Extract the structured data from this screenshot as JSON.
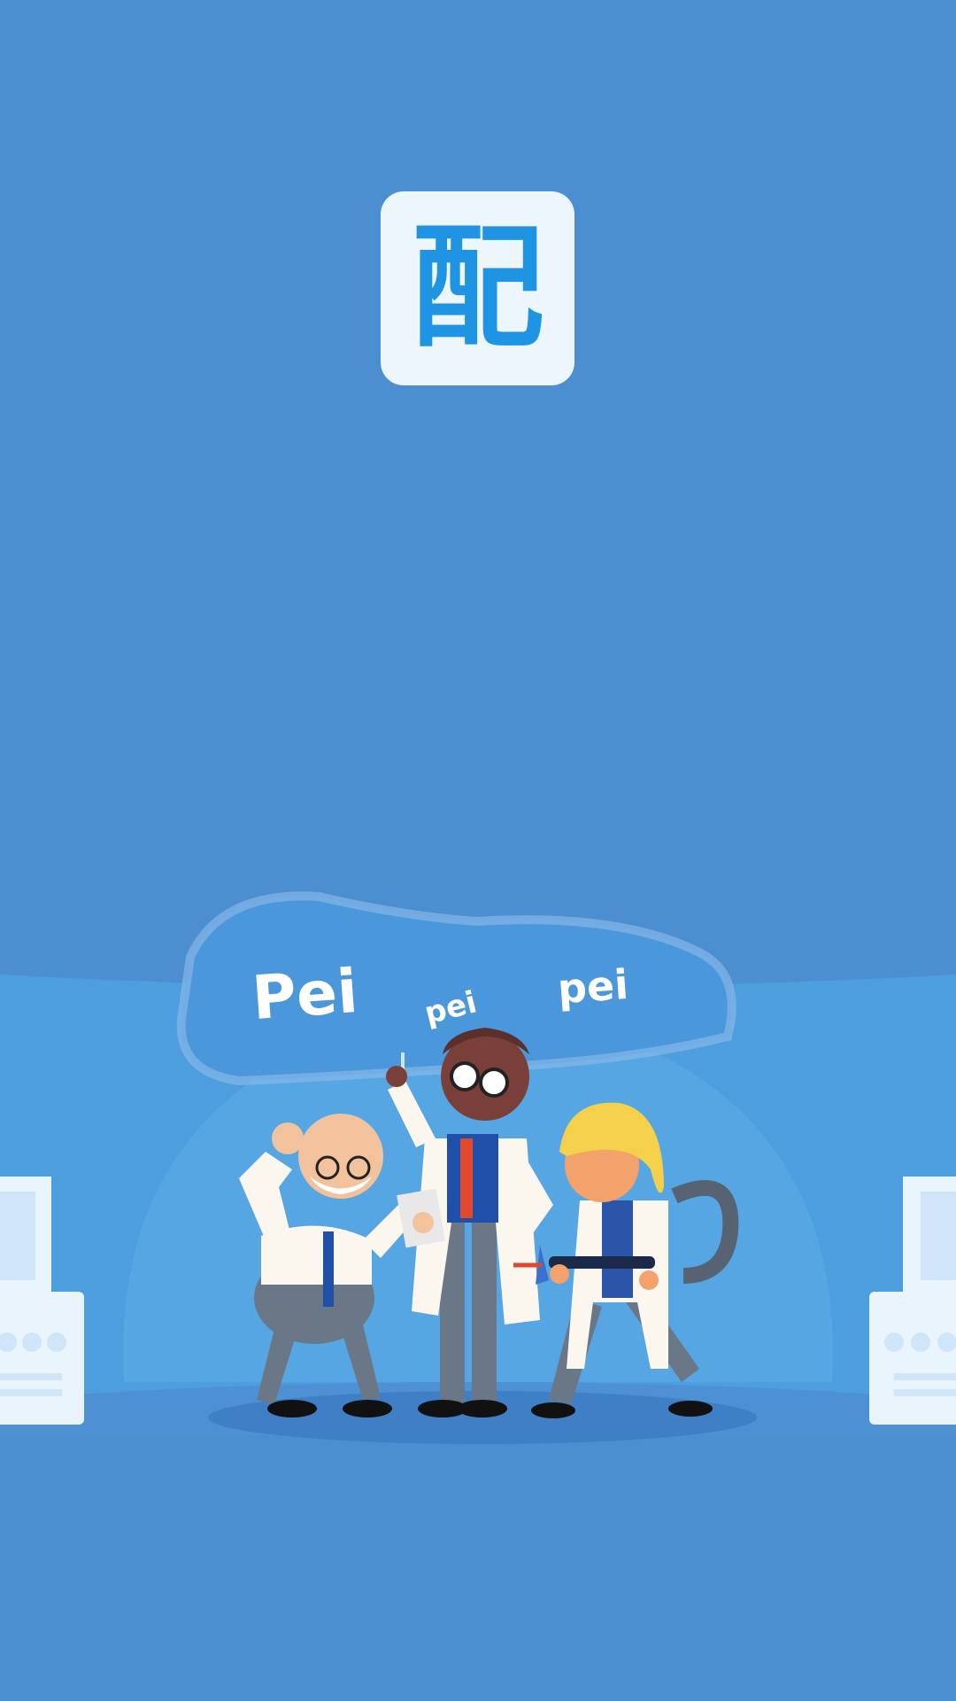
{
  "splash": {
    "logo_char": "配",
    "bubble_words": [
      "Pei",
      "pei",
      "pei"
    ]
  },
  "colors": {
    "background": "#4b8fd1",
    "logo_bg": "#eef6fd",
    "logo_fg": "#1e94e2",
    "stage_light": "#4aa0e0"
  }
}
